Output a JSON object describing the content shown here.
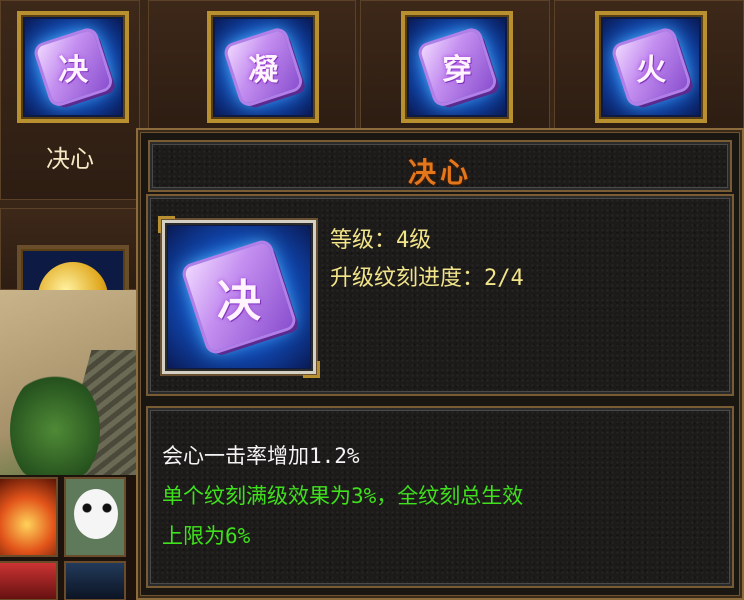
{
  "skill_grid": {
    "skills": [
      {
        "glyph": "决",
        "name": "决心",
        "selected": true
      },
      {
        "glyph": "凝",
        "name": ""
      },
      {
        "glyph": "穿",
        "name": ""
      },
      {
        "glyph": "火",
        "name": ""
      }
    ]
  },
  "tooltip": {
    "title": "决心",
    "icon_glyph": "决",
    "level_text": "等级：4级",
    "progress_text": "升级纹刻进度：2/4",
    "effect_text": "会心一击率增加1.2%",
    "note_line1": "单个纹刻满级效果为3%，全纹刻总生效",
    "note_line2": "上限为6%"
  },
  "colors": {
    "title": "#e4771c",
    "stat": "#f2e48a",
    "effect": "#f4f4f4",
    "note": "#3fe01c",
    "frame_gold": "#b8902f"
  }
}
